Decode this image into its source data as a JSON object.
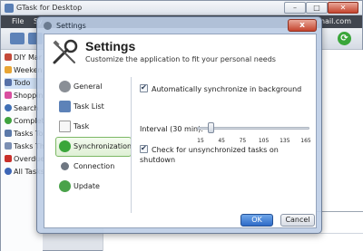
{
  "main": {
    "title": "GTask for Desktop",
    "menu": [
      "File",
      "Sy"
    ],
    "email_fragment": "mail.com",
    "window_buttons": {
      "minimize": "–",
      "maximize": "□",
      "close": "✕"
    },
    "sidebar_items": [
      {
        "label": "DIY Mar",
        "color": "#c44a3a"
      },
      {
        "label": "Weeken",
        "color": "#e8a535"
      },
      {
        "label": "Todo",
        "color": "#5570a8"
      },
      {
        "label": "Shoppin",
        "color": "#d94fa0"
      },
      {
        "label": "Search",
        "color": "#3f6fb5"
      },
      {
        "label": "Complet",
        "color": "#3fa33f"
      },
      {
        "label": "Tasks To",
        "color": "#5b79a9"
      },
      {
        "label": "Tasks Th",
        "color": "#7b8fb3"
      },
      {
        "label": "Overdue",
        "color": "#c8302b"
      },
      {
        "label": "All Tasks",
        "color": "#3d66b6"
      }
    ]
  },
  "dialog": {
    "title": "Settings",
    "close_label": "x",
    "heading": "Settings",
    "subheading": "Customize the application to fit your personal needs",
    "nav": [
      {
        "label": "General",
        "color": "#8a8f96"
      },
      {
        "label": "Task List",
        "color": "#5d82b8"
      },
      {
        "label": "Task",
        "color": "#f2f2f2"
      },
      {
        "label": "Synchronization",
        "color": "#3aa63a"
      },
      {
        "label": "Connection",
        "color": "#6f7782"
      },
      {
        "label": "Update",
        "color": "#4aa24a"
      }
    ],
    "auto_sync_label": "Automatically synchronize in background",
    "auto_sync_checked": true,
    "interval_label": "Interval (30 min):",
    "interval_ticks": [
      "15",
      "45",
      "75",
      "105",
      "135",
      "165"
    ],
    "interval_value_min": 30,
    "check_unsync_label": "Check for unsynchronized tasks on shutdown",
    "check_unsync_checked": true,
    "ok_label": "OK",
    "cancel_label": "Cancel"
  }
}
